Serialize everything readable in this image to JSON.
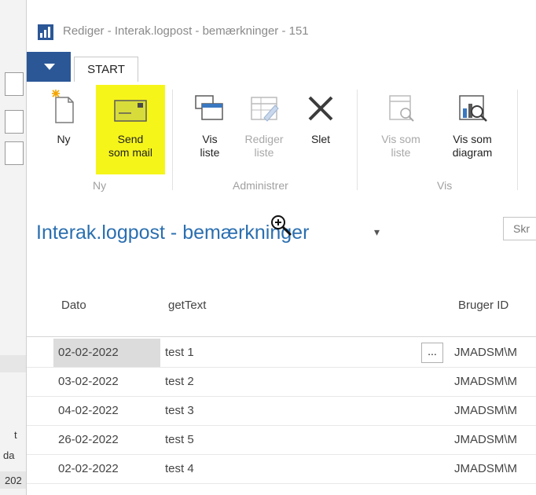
{
  "background_window": {
    "side_text": [
      "t",
      "da",
      "202"
    ]
  },
  "window": {
    "title": "Rediger - Interak.logpost - bemærkninger - 151"
  },
  "ribbon_tabs": {
    "active": "START"
  },
  "ribbon": {
    "groups": [
      {
        "label": "Ny",
        "buttons": [
          {
            "label1": "Ny",
            "label2": "",
            "icon": "new-document-icon",
            "enabled": true
          },
          {
            "label1": "Send",
            "label2": "som mail",
            "icon": "envelope-icon",
            "enabled": true
          }
        ]
      },
      {
        "label": "Administrer",
        "buttons": [
          {
            "label1": "Vis",
            "label2": "liste",
            "icon": "view-list-icon",
            "enabled": true
          },
          {
            "label1": "Rediger",
            "label2": "liste",
            "icon": "edit-list-icon",
            "enabled": false
          },
          {
            "label1": "Slet",
            "label2": "",
            "icon": "delete-x-icon",
            "enabled": true
          }
        ]
      },
      {
        "label": "Vis",
        "buttons": [
          {
            "label1": "Vis som",
            "label2": "liste",
            "icon": "show-as-list-icon",
            "enabled": false
          },
          {
            "label1": "Vis som",
            "label2": "diagram",
            "icon": "show-as-chart-icon",
            "enabled": true
          }
        ]
      }
    ],
    "highlight_color": "#f6f51a"
  },
  "page": {
    "title": "Interak.logpost - bemærkninger",
    "search_placeholder": "Skr"
  },
  "table": {
    "columns": [
      "Dato",
      "getText",
      "Bruger ID"
    ],
    "rows": [
      {
        "date": "02-02-2022",
        "text": "test 1",
        "user": "JMADSM\\M",
        "selected": true
      },
      {
        "date": "03-02-2022",
        "text": "test 2",
        "user": "JMADSM\\M"
      },
      {
        "date": "04-02-2022",
        "text": "test 3",
        "user": "JMADSM\\M"
      },
      {
        "date": "26-02-2022",
        "text": "test 5",
        "user": "JMADSM\\M"
      },
      {
        "date": "02-02-2022",
        "text": "test 4",
        "user": "JMADSM\\M"
      }
    ],
    "lookup_label": "..."
  },
  "colors": {
    "accent": "#2b5797",
    "title_blue": "#2b6fb0"
  }
}
